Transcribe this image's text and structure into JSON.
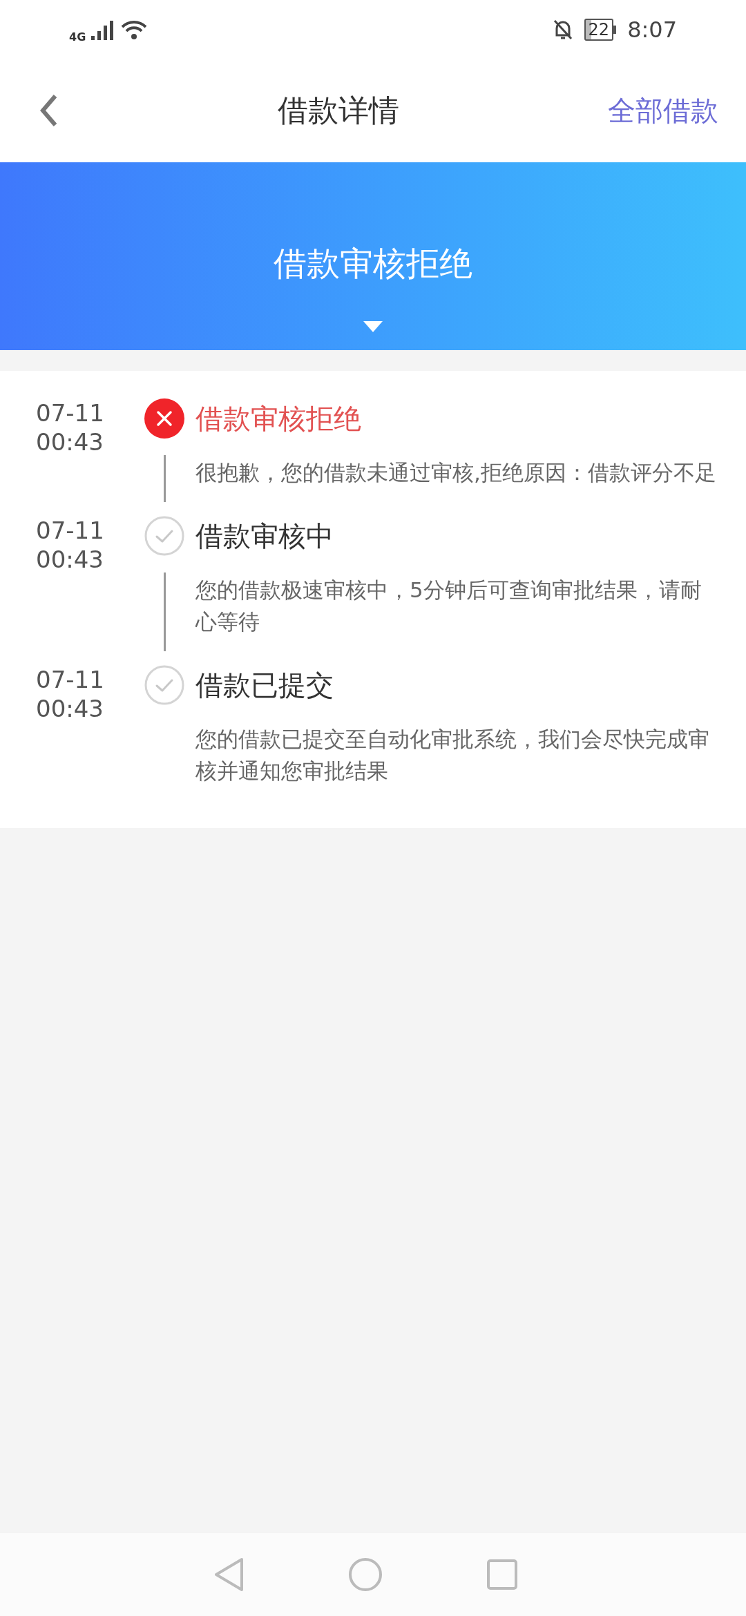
{
  "status_bar": {
    "network": "4G",
    "battery": "22",
    "time": "8:07"
  },
  "header": {
    "title": "借款详情",
    "action": "全部借款"
  },
  "banner": {
    "status": "借款审核拒绝"
  },
  "timeline": [
    {
      "kind": "rejected",
      "date": "07-11",
      "time": "00:43",
      "title": "借款审核拒绝",
      "description": "很抱歉，您的借款未通过审核,拒绝原因：借款评分不足"
    },
    {
      "kind": "done",
      "date": "07-11",
      "time": "00:43",
      "title": "借款审核中",
      "description": "您的借款极速审核中，5分钟后可查询审批结果，请耐心等待"
    },
    {
      "kind": "done",
      "date": "07-11",
      "time": "00:43",
      "title": "借款已提交",
      "description": "您的借款已提交至自动化审批系统，我们会尽快完成审核并通知您审批结果"
    }
  ]
}
